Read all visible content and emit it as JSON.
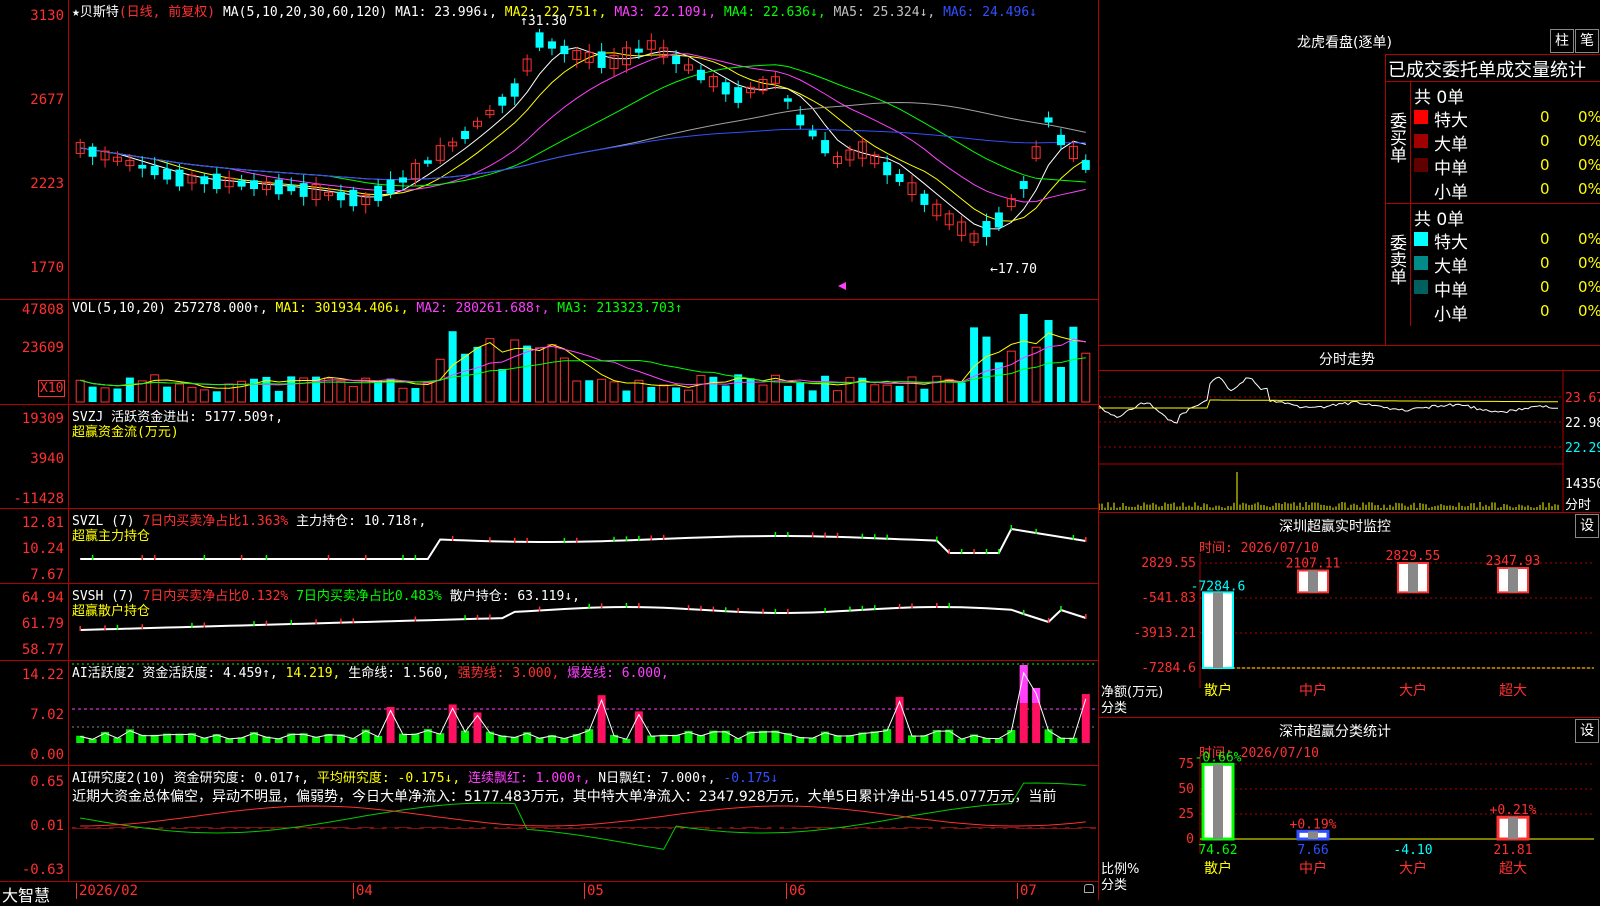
{
  "main": {
    "stock_label": "★贝斯特",
    "period_label": "(日线, 前复权)",
    "ma_params": "MA(5,10,20,30,60,120)",
    "ma_values": [
      {
        "label": "MA1: 23.996↓,",
        "color": "#ffffff"
      },
      {
        "label": "MA2: 22.751↑,",
        "color": "#ffff00"
      },
      {
        "label": "MA3: 22.109↓,",
        "color": "#ff40ff"
      },
      {
        "label": "MA4: 22.636↓,",
        "color": "#00ff00"
      },
      {
        "label": "MA5: 25.324↓,",
        "color": "#c0c0c0"
      },
      {
        "label": "MA6: 24.496↓",
        "color": "#3050ff"
      }
    ],
    "y_ticks": [
      "3130",
      "2677",
      "2223",
      "1770"
    ],
    "high_marker": "31.30",
    "low_marker": "←17.70"
  },
  "volume": {
    "title": "VOL(5,10,20)",
    "value": "257278.000↑,",
    "ma1": "MA1: 301934.406↓,",
    "ma2": "MA2: 280261.688↑,",
    "ma3": "MA3: 213323.703↑",
    "y_ticks": [
      "47808",
      "23609"
    ],
    "unit": "X10"
  },
  "svzj": {
    "title": "SVZJ",
    "text": "活跃资金进出: 5177.509↑,",
    "sub": "超赢资金流(万元)",
    "y_ticks": [
      "19309",
      "3940",
      "-11428"
    ]
  },
  "svzl": {
    "title": "SVZL (7)",
    "text1": "7日内买卖净占比1.363%",
    "text2": "主力持仓: 10.718↑,",
    "sub": "超赢主力持仓",
    "y_ticks": [
      "12.81",
      "10.24",
      "7.67"
    ]
  },
  "svsh": {
    "title": "SVSH (7)",
    "text1": "7日内买卖净占比0.132%",
    "text2": "7日内买卖净占比0.483%",
    "text3": "散户持仓: 63.119↓,",
    "sub": "超赢散户持仓",
    "y_ticks": [
      "64.94",
      "61.79",
      "58.77"
    ]
  },
  "ai1": {
    "title": "AI活跃度2",
    "t1": "资金活跃度: 4.459↑,",
    "t2": "14.219,",
    "t3": "生命线: 1.560,",
    "t4": "强势线: 3.000,",
    "t5": "爆发线: 6.000,",
    "y_ticks": [
      "14.22",
      "7.02",
      "0.00"
    ]
  },
  "ai2": {
    "title": "AI研究度2(10)",
    "t1": "资金研究度: 0.017↑,",
    "t2": "平均研究度: -0.175↓,",
    "t3": "连续飘红: 1.000↑,",
    "t4": "N日飘红: 7.000↑,",
    "t5": "-0.175↓",
    "commentary": "近期大资金总体偏空，异动不明显，偏弱势，今日大单净流入：5177.483万元，其中特大单净流入：2347.928万元，大单5日累计净出-5145.077万元，当前",
    "y_ticks": [
      "0.65",
      "0.01",
      "-0.63"
    ]
  },
  "footer": {
    "brand": "大智慧",
    "dates": [
      "2026/02",
      "04",
      "05",
      "06",
      "07"
    ]
  },
  "right": {
    "title": "龙虎看盘(逐单)",
    "btn_bar": "柱",
    "btn_pen": "笔",
    "tabs_text": "已成交委托单成交量统计",
    "buy_label": "委买单",
    "sell_label": "委卖单",
    "buy_total": "共 0单",
    "sell_total": "共 0单",
    "buy_rows": [
      {
        "label": "特大",
        "count": "0",
        "pct": "0%",
        "color": "#ff0000"
      },
      {
        "label": "大单",
        "count": "0",
        "pct": "0%",
        "color": "#a00000"
      },
      {
        "label": "中单",
        "count": "0",
        "pct": "0%",
        "color": "#600000"
      },
      {
        "label": "小单",
        "count": "0",
        "pct": "0%",
        "color": "#000000"
      }
    ],
    "sell_rows": [
      {
        "label": "特大",
        "count": "0",
        "pct": "0%",
        "color": "#00ffff"
      },
      {
        "label": "大单",
        "count": "0",
        "pct": "0%",
        "color": "#008a8a"
      },
      {
        "label": "中单",
        "count": "0",
        "pct": "0%",
        "color": "#006060"
      },
      {
        "label": "小单",
        "count": "0",
        "pct": "0%",
        "color": "#000000"
      }
    ],
    "intraday_title": "分时走势",
    "intraday_ticks": [
      "23.67",
      "22.98",
      "22.29"
    ],
    "intraday_vol": "14350",
    "intraday_fenshi": "分时",
    "sz_monitor": {
      "title": "深圳超赢实时监控",
      "btn": "设",
      "date": "时间: 2026/07/10",
      "y_ticks": [
        "2829.55",
        "-541.83",
        "-3913.21",
        "-7284.6"
      ],
      "ylabel1": "净额(万元)",
      "ylabel2": "分类",
      "categories": [
        "散户",
        "中户",
        "大户",
        "超大"
      ],
      "values": [
        -7284.6,
        2107.11,
        2829.55,
        2347.93
      ],
      "value_labels": [
        "-7284.6",
        "2107.11",
        "2829.55",
        "2347.93"
      ]
    },
    "sz_class": {
      "title": "深市超赢分类统计",
      "btn": "设",
      "date": "时间: 2026/07/10",
      "y_ticks": [
        "75",
        "50",
        "25",
        "0"
      ],
      "ylabel1": "比例%",
      "ylabel2": "分类",
      "categories": [
        "散户",
        "中户",
        "大户",
        "超大"
      ],
      "values": [
        74.62,
        7.66,
        -4.1,
        21.81
      ],
      "value_labels": [
        "74.62",
        "7.66",
        "-4.10",
        "21.81"
      ],
      "change_labels": [
        "-0.66%",
        "+0.19%",
        "",
        "+0.21%"
      ]
    }
  }
}
